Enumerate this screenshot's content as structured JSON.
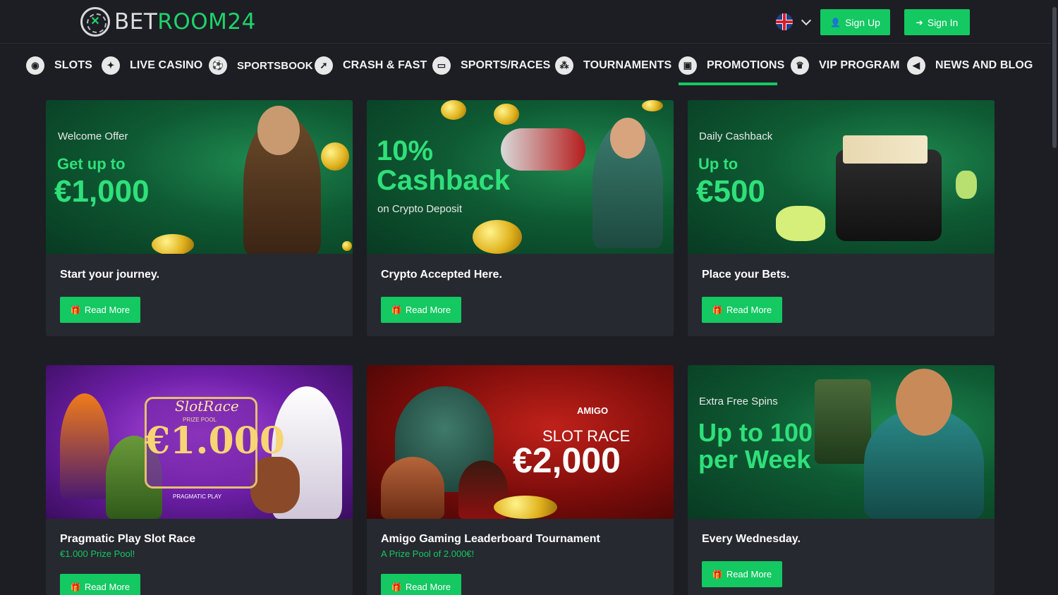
{
  "header": {
    "logo_left": "BET",
    "logo_right": "ROOM24",
    "signup_label": "Sign Up",
    "signin_label": "Sign In"
  },
  "nav": [
    {
      "label": "SLOTS",
      "icon": "slots-icon",
      "glyph": "◉"
    },
    {
      "label": "LIVE CASINO",
      "icon": "live-casino-icon",
      "glyph": "✦"
    },
    {
      "label": "SPORTSBOOK",
      "icon": "sportsbook-icon",
      "glyph": "⚽"
    },
    {
      "label": "CRASH & FAST",
      "icon": "crash-fast-icon",
      "glyph": "➚"
    },
    {
      "label": "SPORTS/RACES",
      "icon": "sports-races-icon",
      "glyph": "▭"
    },
    {
      "label": "TOURNAMENTS",
      "icon": "tournaments-icon",
      "glyph": "⁂"
    },
    {
      "label": "PROMOTIONS",
      "icon": "promotions-icon",
      "glyph": "▣"
    },
    {
      "label": "VIP PROGRAM",
      "icon": "vip-program-icon",
      "glyph": "♛"
    },
    {
      "label": "NEWS AND BLOG",
      "icon": "news-blog-icon",
      "glyph": "◀"
    }
  ],
  "active_nav": "PROMOTIONS",
  "colors": {
    "accent": "#14c862",
    "background": "#1c1e24",
    "card": "#262930"
  },
  "read_more_label": "Read More",
  "cards": [
    {
      "banner_small": "Welcome Offer",
      "banner_line1": "Get up to",
      "banner_big": "€1,000",
      "title": "Start your journey.",
      "subtitle": ""
    },
    {
      "banner_big": "10%",
      "banner_line1": "Cashback",
      "banner_small": "on Crypto Deposit",
      "title": "Crypto Accepted Here.",
      "subtitle": ""
    },
    {
      "banner_small": "Daily Cashback",
      "banner_line1": "Up to",
      "banner_big": "€500",
      "title": "Place your Bets.",
      "subtitle": ""
    },
    {
      "banner_small": "PRIZE POOL",
      "banner_line1": "SlotRace",
      "banner_big": "€1.000",
      "banner_brand": "PRAGMATIC PLAY",
      "title": "Pragmatic Play Slot Race",
      "subtitle": "€1.000 Prize Pool!"
    },
    {
      "banner_brand": "AMIGO",
      "banner_small": "SLOT RACE",
      "banner_big": "€2,000",
      "title": "Amigo Gaming Leaderboard Tournament",
      "subtitle": "A Prize Pool of 2.000€!"
    },
    {
      "banner_small": "Extra Free Spins",
      "banner_line1": "Up to 100",
      "banner_big": "per Week",
      "title": "Every Wednesday.",
      "subtitle": ""
    }
  ]
}
